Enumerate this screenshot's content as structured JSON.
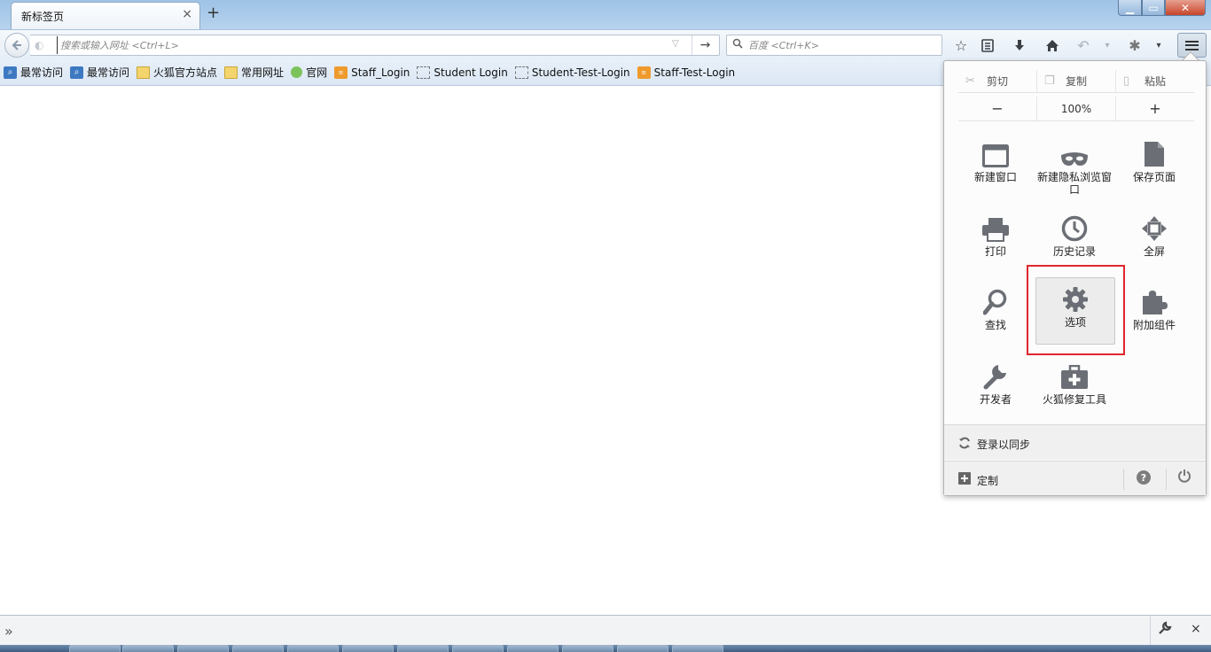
{
  "window": {
    "tab_title": "新标签页",
    "tab_close": "×",
    "new_tab": "+",
    "minimize": "▁",
    "maximize": "▭",
    "close": "✕"
  },
  "navbar": {
    "url_placeholder": "搜索或输入网址 <Ctrl+L>",
    "search_placeholder": "百度 <Ctrl+K>",
    "go_arrow": "→"
  },
  "bookmarks": [
    {
      "label": "最常访问",
      "icon": "bookmark-blue-icon"
    },
    {
      "label": "最常访问",
      "icon": "bookmark-blue-icon"
    },
    {
      "label": "火狐官方站点",
      "icon": "folder-icon"
    },
    {
      "label": "常用网址",
      "icon": "folder-icon"
    },
    {
      "label": "官网",
      "icon": "green-globe-icon"
    },
    {
      "label": "Staff_Login",
      "icon": "orange-site-icon"
    },
    {
      "label": "Student Login",
      "icon": "dashed-page-icon"
    },
    {
      "label": "Student-Test-Login",
      "icon": "dashed-page-icon"
    },
    {
      "label": "Staff-Test-Login",
      "icon": "orange-site-icon"
    }
  ],
  "menu": {
    "edit": {
      "cut": "剪切",
      "copy": "复制",
      "paste": "粘贴"
    },
    "zoom": {
      "minus": "−",
      "level": "100%",
      "plus": "+"
    },
    "items": {
      "new_window": "新建窗口",
      "new_private": "新建隐私浏览窗口",
      "save_page": "保存页面",
      "print": "打印",
      "history": "历史记录",
      "fullscreen": "全屏",
      "find": "查找",
      "options": "选项",
      "addons": "附加组件",
      "developer": "开发者",
      "repair_tool": "火狐修复工具"
    },
    "sync": "登录以同步",
    "customize": "定制",
    "help": "?"
  },
  "addonbar": {
    "chevron": "»",
    "close": "×"
  },
  "colors": {
    "highlight": "#e0262e",
    "icon_gray": "#6b6f75"
  }
}
